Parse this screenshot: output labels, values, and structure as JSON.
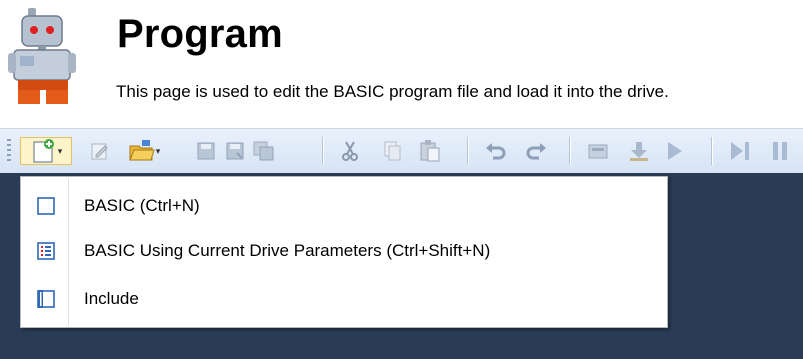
{
  "header": {
    "title": "Program",
    "subtitle": "This page is used to edit the BASIC program file  and load it into the drive."
  },
  "toolbar": {
    "buttons": [
      {
        "icon": "new-file-icon",
        "active": true
      },
      {
        "icon": "edit-icon"
      },
      {
        "icon": "open-folder-icon"
      },
      {
        "icon": "save-icon"
      },
      {
        "icon": "save-as-icon"
      },
      {
        "icon": "save-all-icon"
      },
      {
        "icon": "cut-icon"
      },
      {
        "icon": "copy-icon"
      },
      {
        "icon": "paste-icon"
      },
      {
        "icon": "undo-icon"
      },
      {
        "icon": "redo-icon"
      },
      {
        "icon": "compile-icon"
      },
      {
        "icon": "download-icon"
      },
      {
        "icon": "run-icon"
      },
      {
        "icon": "step-icon"
      },
      {
        "icon": "pause-icon"
      }
    ]
  },
  "new_menu": {
    "items": [
      {
        "label": "BASIC (Ctrl+N)",
        "icon": "blank-document-icon"
      },
      {
        "label": "BASIC Using Current Drive Parameters (Ctrl+Shift+N)",
        "icon": "parameter-list-icon"
      },
      {
        "label": "Include",
        "icon": "include-file-icon"
      }
    ]
  },
  "colors": {
    "toolbar": "#dde8f6",
    "editor_bg": "#2a3b55",
    "menu_bg": "#ffffff",
    "active_button": "#fdf4c9"
  }
}
